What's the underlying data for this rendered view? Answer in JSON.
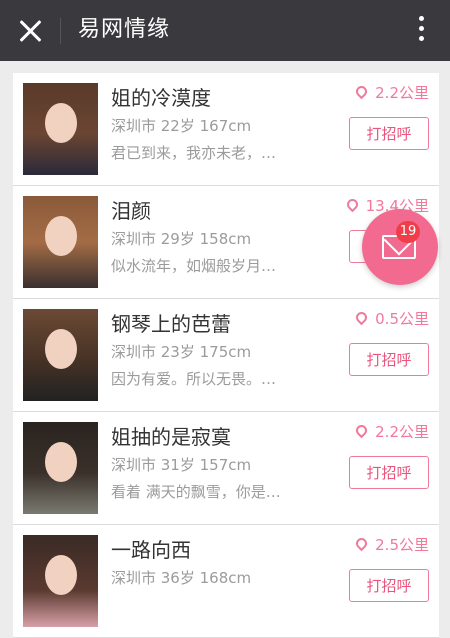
{
  "header": {
    "title": "易网情缘",
    "close_icon": "close-icon",
    "more_icon": "more-vertical-icon",
    "bg_color": "#3a3a3e"
  },
  "accent_color": "#f1799b",
  "profiles": [
    {
      "name": "姐的冷漠度",
      "info": "深圳市 22岁 167cm",
      "bio": "君已到来，我亦未老，…",
      "distance": "2.2公里",
      "greet_label": "打招呼"
    },
    {
      "name": "泪颜",
      "info": "深圳市 29岁 158cm",
      "bio": "似水流年，如烟般岁月…",
      "distance": "13.4公里",
      "greet_label": "打招呼"
    },
    {
      "name": "钢琴上的芭蕾",
      "info": "深圳市 23岁 175cm",
      "bio": "因为有爱。所以无畏。…",
      "distance": "0.5公里",
      "greet_label": "打招呼"
    },
    {
      "name": "姐抽的是寂寞",
      "info": "深圳市 31岁 157cm",
      "bio": "看着 满天的飘雪，你是…",
      "distance": "2.2公里",
      "greet_label": "打招呼"
    },
    {
      "name": "一路向西",
      "info": "深圳市 36岁 168cm",
      "bio": "",
      "distance": "2.5公里",
      "greet_label": "打招呼"
    }
  ],
  "floating_message": {
    "icon": "envelope-icon",
    "badge_count": "19"
  }
}
